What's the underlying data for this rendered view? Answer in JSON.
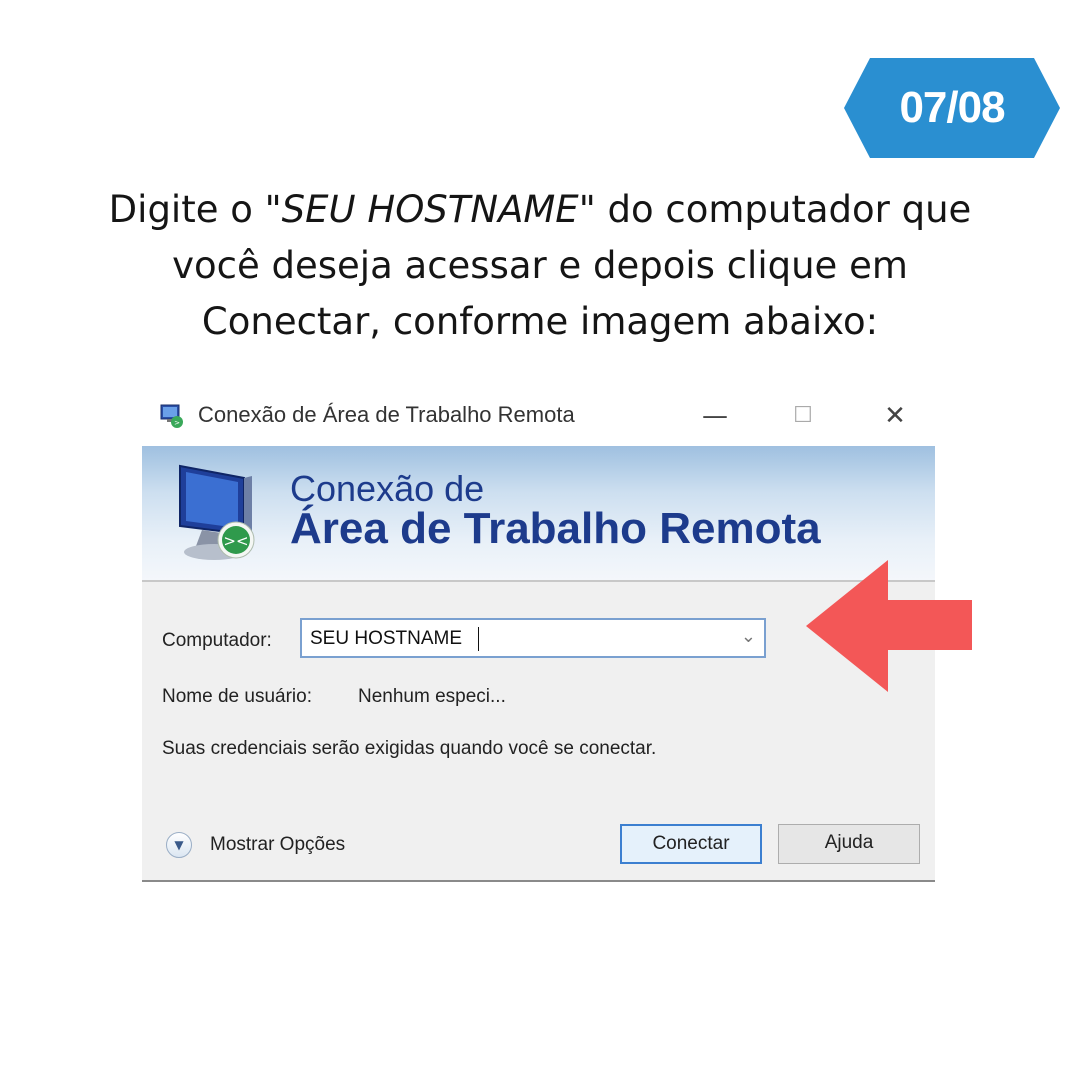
{
  "step_badge": {
    "label": "07/08",
    "color": "#2a8fd1"
  },
  "instruction": {
    "part1": "Digite o ",
    "emphasis": "\"SEU HOSTNAME\"",
    "part2": " do computador que você deseja acessar e depois clique em Conectar, conforme imagem abaixo:"
  },
  "dialog": {
    "window_title": "Conexão de Área de Trabalho Remota",
    "title_icon": "remote-desktop-icon",
    "window_controls": {
      "minimize": "—",
      "maximize": "☐",
      "close": "✕"
    },
    "banner": {
      "line1": "Conexão de",
      "line2": "Área de Trabalho Remota",
      "icon": "monitor-icon"
    },
    "computer_label": "Computador:",
    "computer_value": "SEU HOSTNAME",
    "username_label": "Nome de usuário:",
    "username_value": "Nenhum especi...",
    "credentials_note": "Suas credenciais serão exigidas quando você se conectar.",
    "show_options_label": "Mostrar Opções",
    "connect_label": "Conectar",
    "help_label": "Ajuda"
  },
  "pointer_arrow": {
    "color": "#f35757",
    "icon": "arrow-left-icon"
  }
}
